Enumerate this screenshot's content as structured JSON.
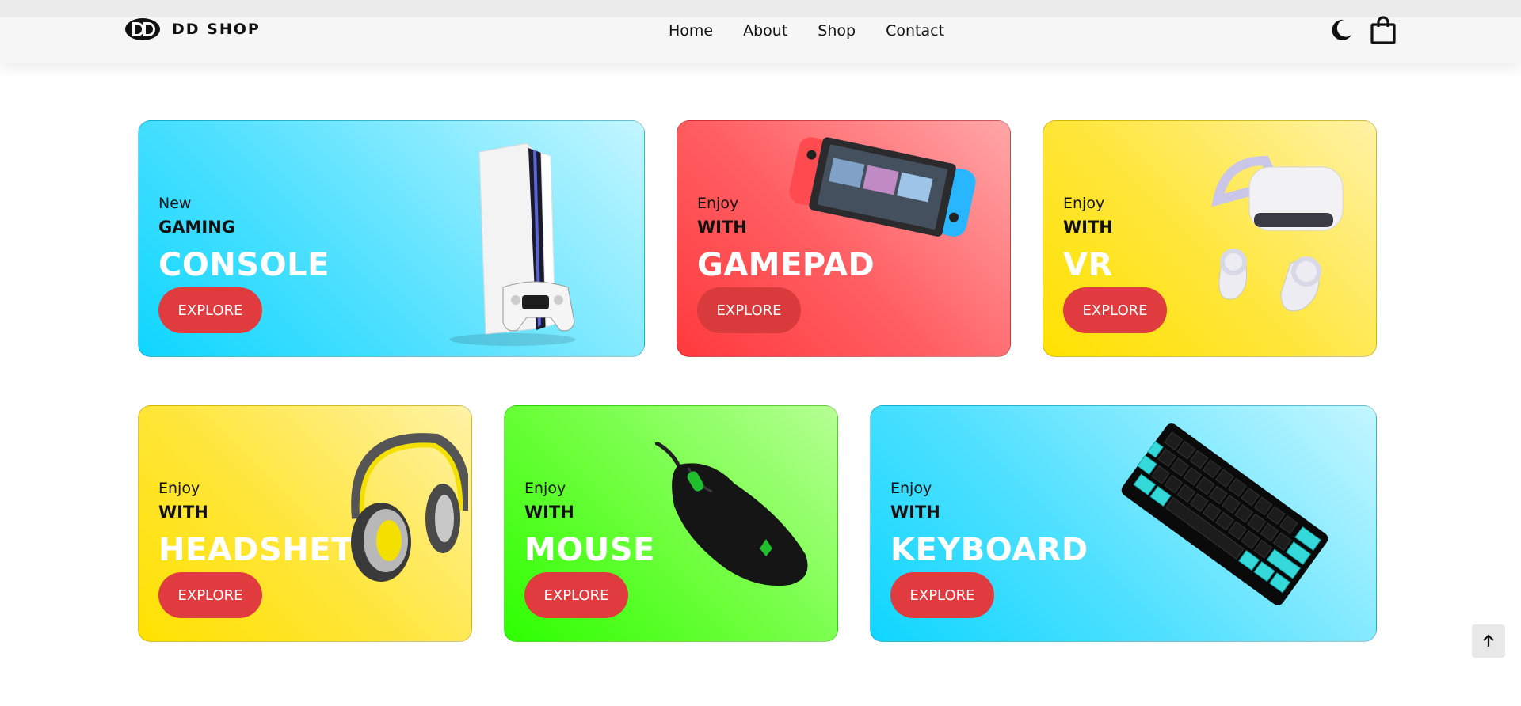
{
  "brand": {
    "name": "DD SHOP",
    "logo_icon": "dd-logo-icon"
  },
  "nav": {
    "items": [
      {
        "label": "Home"
      },
      {
        "label": "About"
      },
      {
        "label": "Shop"
      },
      {
        "label": "Contact"
      }
    ]
  },
  "header_icons": {
    "theme_icon": "moon-icon",
    "cart_icon": "shopping-bag-icon"
  },
  "cards": [
    {
      "id": "console",
      "line1": "New",
      "line2": "GAMING",
      "line3": "CONSOLE",
      "button": "EXPLORE",
      "image": "game-console-image"
    },
    {
      "id": "gamepad",
      "line1": "Enjoy",
      "line2": "WITH",
      "line3": "GAMEPAD",
      "button": "EXPLORE",
      "image": "handheld-console-image"
    },
    {
      "id": "vr",
      "line1": "Enjoy",
      "line2": "WITH",
      "line3": "VR",
      "button": "EXPLORE",
      "image": "vr-headset-image"
    },
    {
      "id": "headset",
      "line1": "Enjoy",
      "line2": "WITH",
      "line3": "HEADSHET",
      "button": "EXPLORE",
      "image": "headset-image"
    },
    {
      "id": "mouse",
      "line1": "Enjoy",
      "line2": "WITH",
      "line3": "MOUSE",
      "button": "EXPLORE",
      "image": "mouse-image"
    },
    {
      "id": "keyboard",
      "line1": "Enjoy",
      "line2": "WITH",
      "line3": "KEYBOARD",
      "button": "EXPLORE",
      "image": "keyboard-image"
    }
  ],
  "colors": {
    "button": "#e03c3f",
    "cyan": "#0fd6ff",
    "red": "#ff3a3e",
    "yellow": "#ffe100",
    "green": "#2dff00"
  },
  "scroll_top_icon": "arrow-up-icon"
}
